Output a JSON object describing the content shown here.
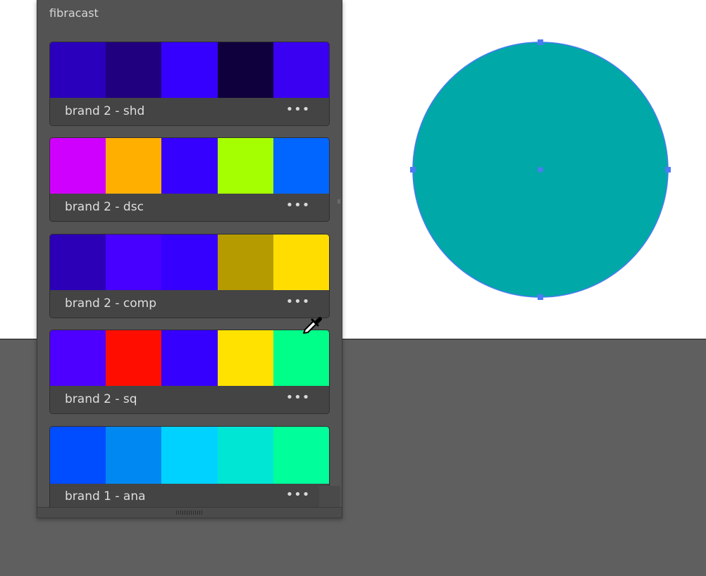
{
  "panel": {
    "title": "fibracast",
    "themes": [
      {
        "name": "brand 2 - shd",
        "colors": [
          "#2a00bd",
          "#20007f",
          "#3600ff",
          "#0f003d",
          "#3a00f2"
        ]
      },
      {
        "name": "brand 2 - dsc",
        "colors": [
          "#d000ff",
          "#ffaf00",
          "#3600ff",
          "#a6ff00",
          "#0066ff"
        ]
      },
      {
        "name": "brand 2 - comp",
        "colors": [
          "#2b00b6",
          "#4700ff",
          "#3600ff",
          "#b59a00",
          "#ffdd00"
        ]
      },
      {
        "name": "brand 2 - sq",
        "colors": [
          "#4d00ff",
          "#ff0e00",
          "#3600ff",
          "#ffe200",
          "#00ff88"
        ]
      },
      {
        "name": "brand 1 - ana",
        "colors": [
          "#004cff",
          "#0088f2",
          "#00d2ff",
          "#00e6d5",
          "#00ff9b"
        ]
      }
    ],
    "more_glyph": "•••"
  },
  "canvas": {
    "shape": "ellipse",
    "fill": "#00a8a8",
    "selection_color": "#4b7cf3",
    "artboard_color": "#ffffff",
    "pasteboard_color": "#5f5f5f"
  },
  "cursor": {
    "icon": "eyedropper-icon"
  }
}
